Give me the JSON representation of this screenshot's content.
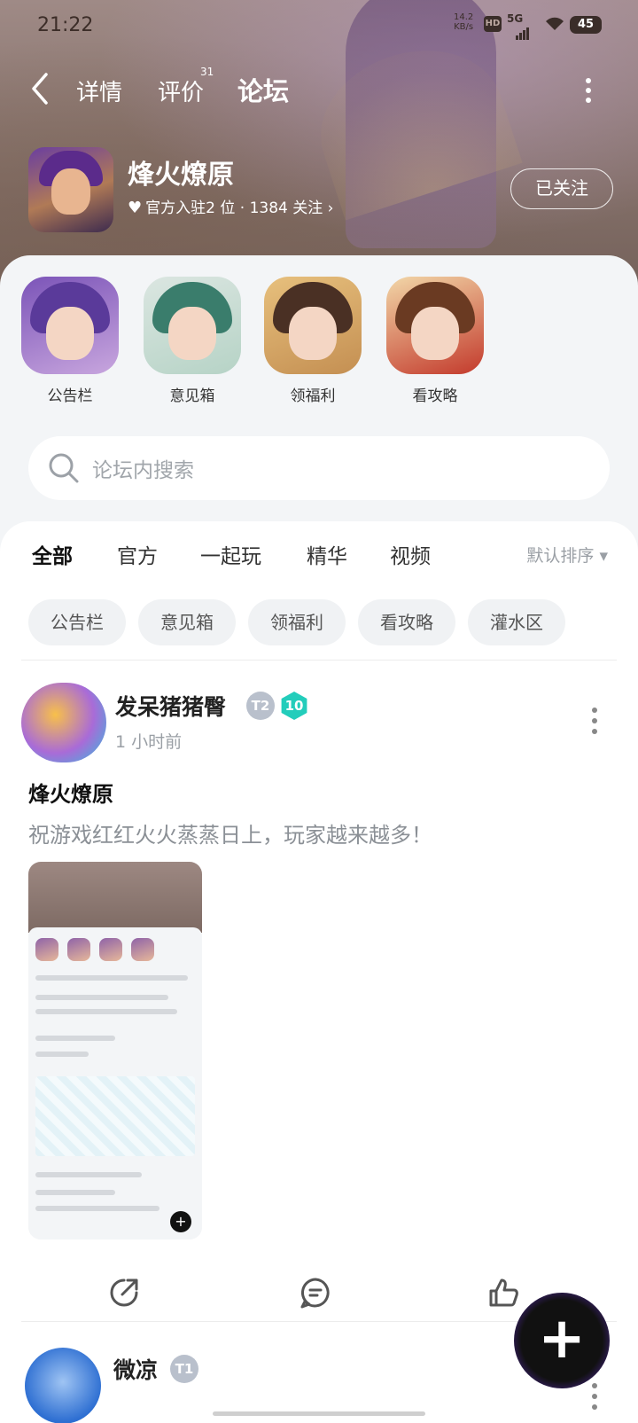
{
  "status_bar": {
    "time": "21:22",
    "rate_value": "14.2",
    "rate_unit": "KB/s",
    "hd": "HD",
    "network": "5G",
    "battery": "45"
  },
  "header": {
    "tabs": [
      {
        "label": "详情"
      },
      {
        "label": "评价",
        "count": "31"
      },
      {
        "label": "论坛"
      }
    ],
    "game": {
      "name": "烽火燎原",
      "meta": "官方入驻2 位 · 1384 关注 ›",
      "follow_label": "已关注"
    }
  },
  "shortcuts": [
    {
      "label": "公告栏"
    },
    {
      "label": "意见箱"
    },
    {
      "label": "领福利"
    },
    {
      "label": "看攻略"
    }
  ],
  "search": {
    "placeholder": "论坛内搜索"
  },
  "filter_tabs": [
    {
      "label": "全部",
      "active": true
    },
    {
      "label": "官方"
    },
    {
      "label": "一起玩"
    },
    {
      "label": "精华"
    },
    {
      "label": "视频"
    }
  ],
  "sort_label": "默认排序 ▾",
  "chips": [
    "公告栏",
    "意见箱",
    "领福利",
    "看攻略",
    "灌水区"
  ],
  "posts": [
    {
      "username": "发呆猪猪臀",
      "badge_t": "T2",
      "badge_level": "10",
      "time": "1 小时前",
      "title": "烽火燎原",
      "body": "祝游戏红红火火蒸蒸日上，玩家越来越多！"
    },
    {
      "username": "微凉",
      "badge_t": "T1"
    }
  ],
  "fab_label": "+"
}
